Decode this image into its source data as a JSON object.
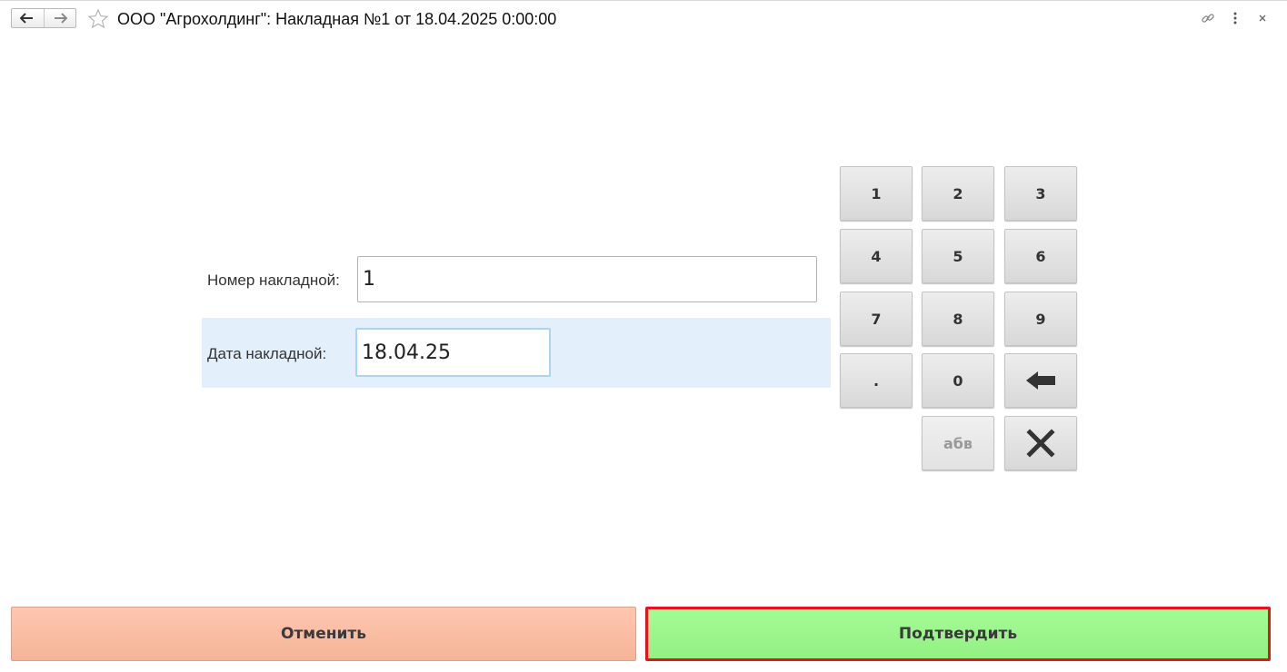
{
  "header": {
    "title": "ООО \"Агрохолдинг\": Накладная №1 от 18.04.2025 0:00:00",
    "back_icon": "arrow-left-icon",
    "forward_icon": "arrow-right-icon",
    "favorite_icon": "star-icon",
    "link_icon": "link-icon",
    "more_icon": "more-vertical-icon",
    "close_icon": "close-icon"
  },
  "form": {
    "number_label": "Номер накладной:",
    "number_value": "1",
    "date_label": "Дата накладной:",
    "date_value": "18.04.25"
  },
  "keypad": {
    "keys": [
      "1",
      "2",
      "3",
      "4",
      "5",
      "6",
      "7",
      "8",
      "9",
      ".",
      "0"
    ],
    "backspace_icon": "backspace-arrow-icon",
    "abc_label": "абв",
    "clear_icon": "clear-x-icon"
  },
  "buttons": {
    "cancel": "Отменить",
    "confirm": "Подтвердить"
  },
  "colors": {
    "cancel_bg": "#ffc6b0",
    "confirm_bg": "#a4fb95",
    "confirm_border": "#e8121b",
    "date_row_bg": "#e3effb"
  }
}
